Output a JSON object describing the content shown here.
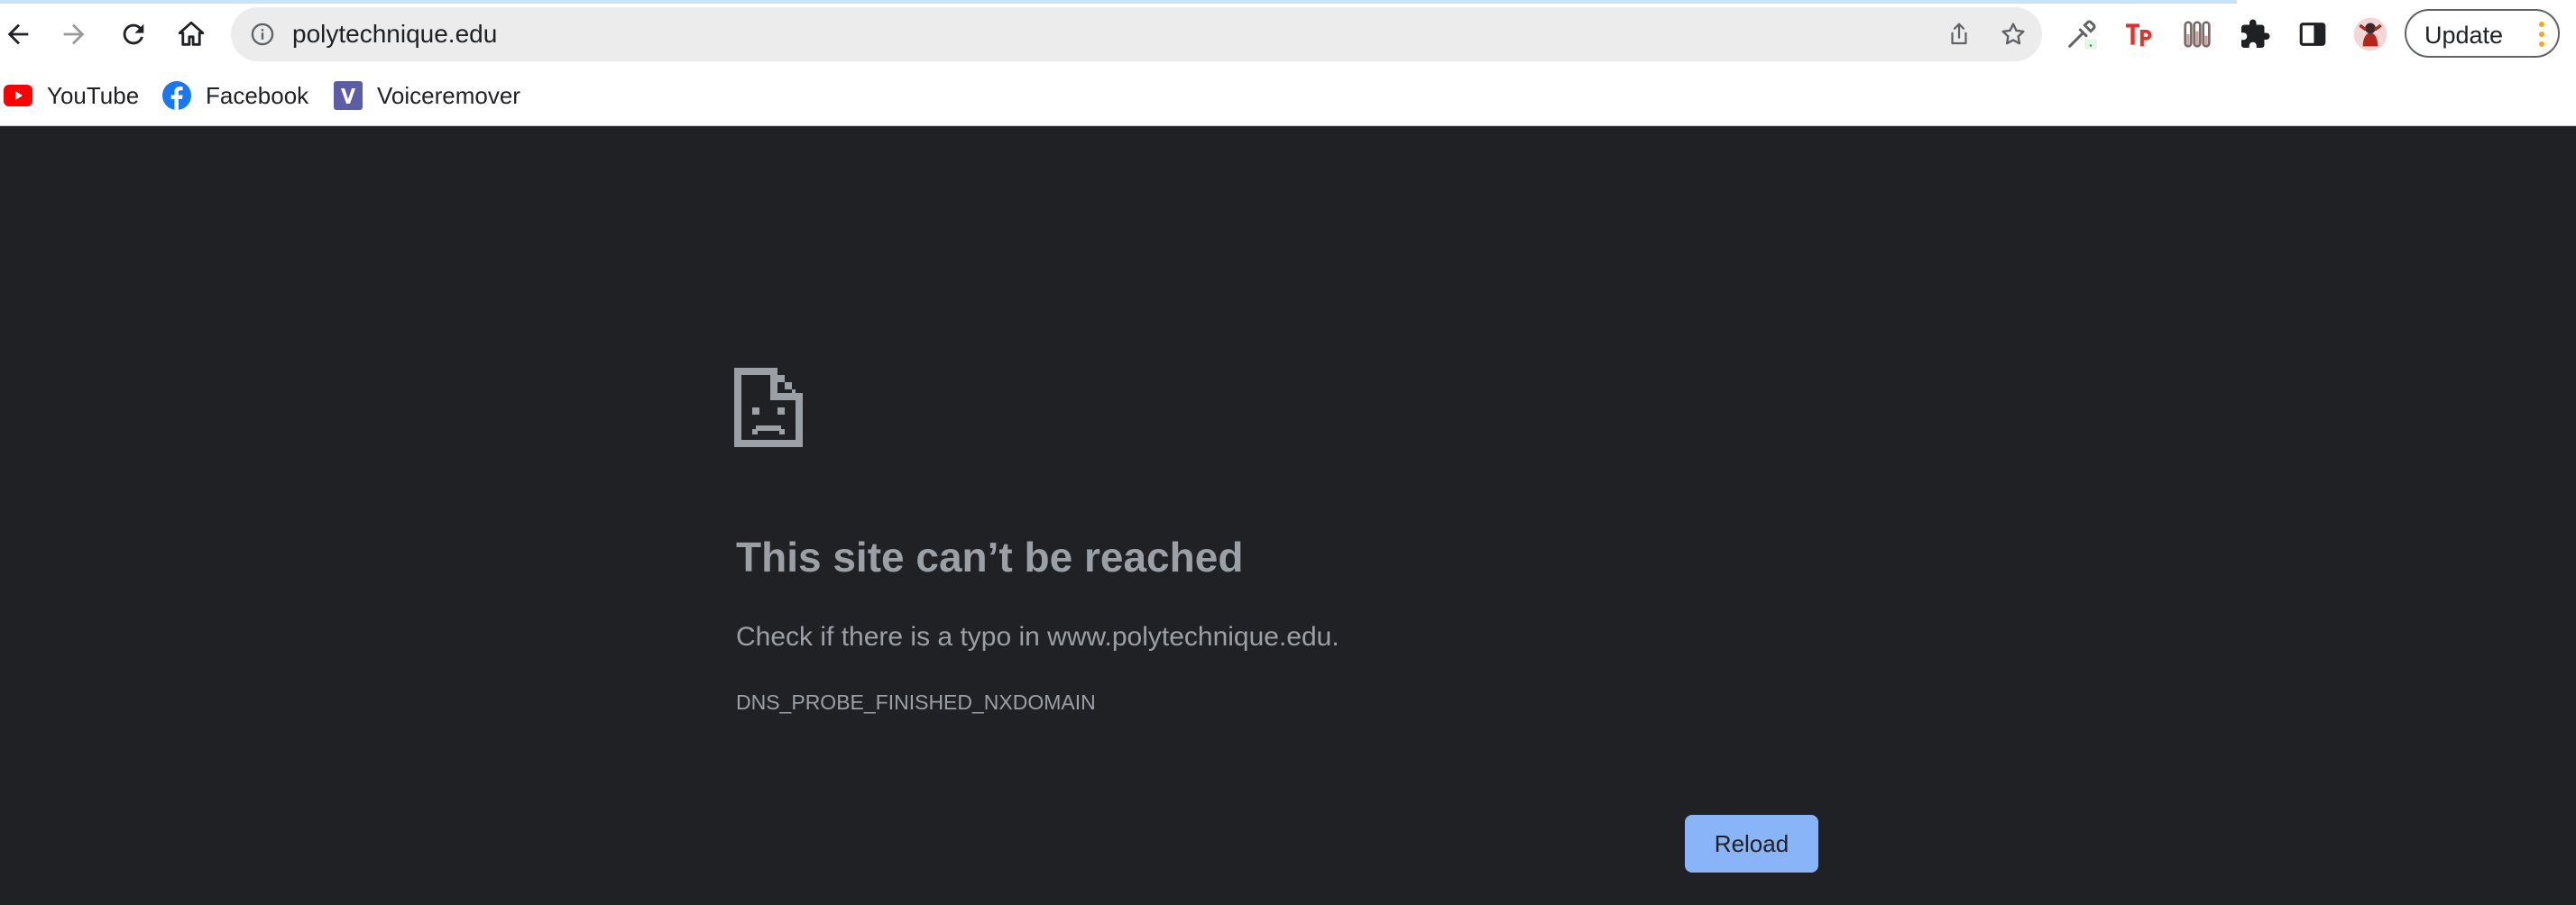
{
  "toolbar": {
    "url": "polytechnique.edu",
    "update_label": "Update"
  },
  "bookmarks": [
    {
      "label": "YouTube",
      "icon": "youtube-icon"
    },
    {
      "label": "Facebook",
      "icon": "facebook-icon"
    },
    {
      "label": "Voiceremover",
      "icon": "voiceremover-icon"
    }
  ],
  "error": {
    "title": "This site can’t be reached",
    "description": "Check if there is a typo in www.polytechnique.edu.",
    "code": "DNS_PROBE_FINISHED_NXDOMAIN",
    "reload_label": "Reload"
  },
  "colors": {
    "page_background": "#202124",
    "text_secondary": "#9aa0a6",
    "reload_button": "#8ab4f8",
    "youtube_red": "#ff0000",
    "facebook_blue": "#1877f2",
    "voiceremover_purple": "#5b5ea6",
    "tp_red": "#e0312f",
    "menu_dots_orange": "#f5a623"
  }
}
